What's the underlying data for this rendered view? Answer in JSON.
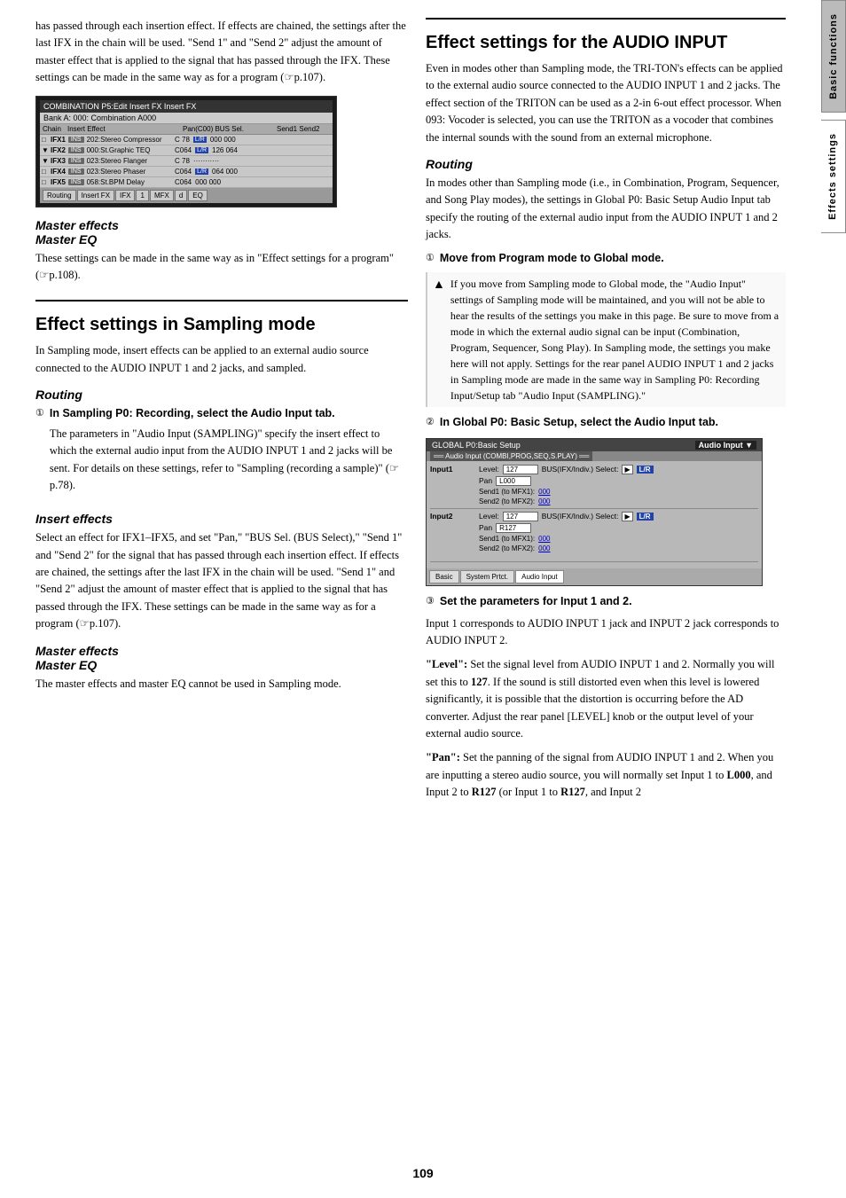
{
  "page": {
    "number": "109",
    "side_tabs": [
      {
        "label": "Basic functions",
        "active": false
      },
      {
        "label": "Effects settings",
        "active": true
      }
    ]
  },
  "left_col": {
    "intro_text": "has passed through each insertion effect. If effects are chained, the settings after the last IFX in the chain will be used. \"Send 1\" and \"Send 2\" adjust the amount of master effect that is applied to the signal that has passed through the IFX. These settings can be made in the same way as for a program (☞p.107).",
    "screenshot": {
      "title": "COMBINATION P5:Edit  Insert FX   Insert FX",
      "row_label": "Bank A: 000: Combination A000",
      "col_headers": [
        "Chain",
        "Insert Effect",
        "Pan(C00) BUS Sel.",
        "Send1 Send2"
      ],
      "rows": [
        {
          "name": "IFX1",
          "effect": "202:Stereo Compressor",
          "flag": "INS",
          "has_lr": true,
          "pan": "C 78",
          "vals": "000 000"
        },
        {
          "name": "IFX2",
          "effect": "000:St.Graphic TEQ",
          "flag": "INS",
          "has_lr": true,
          "pan": "C064",
          "vals": "126 064"
        },
        {
          "name": "IFX3",
          "effect": "023:Stereo Flanger",
          "flag": "INS",
          "has_lr": false,
          "pan": "C 78",
          "vals": ""
        },
        {
          "name": "IFX4",
          "effect": "023:Stereo Phaser",
          "flag": "INS",
          "has_lr": true,
          "pan": "C064",
          "vals": "064 000"
        },
        {
          "name": "IFX5",
          "effect": "058:St.BPM Delay",
          "flag": "INS",
          "has_lr": false,
          "pan": "C064",
          "vals": "000 000"
        }
      ],
      "footer_tabs": [
        "Routing",
        "Insert FX",
        "IFX",
        "MFX",
        "d",
        "EQ"
      ]
    },
    "master_effects_title": "Master effects",
    "master_eq_title": "Master EQ",
    "master_text": "These settings can be made in the same way as in \"Effect settings for a program\" (☞p.108).",
    "sampling_section_title": "Effect settings in Sampling mode",
    "sampling_intro": "In Sampling mode, insert effects can be applied to an external audio source connected to the AUDIO INPUT 1 and 2 jacks, and sampled.",
    "routing_title": "Routing",
    "routing_step1_bold": "In Sampling P0: Recording, select the Audio Input tab.",
    "routing_step1_text": "The parameters in \"Audio Input (SAMPLING)\" specify the insert effect to which the external audio input from the AUDIO INPUT 1 and 2 jacks will be sent. For details on these settings, refer to \"Sampling (recording a sample)\" (☞p.78).",
    "insert_effects_title": "Insert effects",
    "insert_effects_text": "Select an effect for IFX1–IFX5, and set \"Pan,\" \"BUS Sel. (BUS Select),\" \"Send 1\" and \"Send 2\" for the signal that has passed through each insertion effect. If effects are chained, the settings after the last IFX in the chain will be used. \"Send 1\" and \"Send 2\" adjust the amount of master effect that is applied to the signal that has passed through the IFX. These settings can be made in the same way as for a program (☞p.107).",
    "master_effects2_title": "Master effects",
    "master_eq2_title": "Master EQ",
    "master_eq2_text": "The master effects and master EQ cannot be used in Sampling mode."
  },
  "right_col": {
    "audio_input_title": "Effect settings for the AUDIO INPUT",
    "audio_input_intro": "Even in modes other than Sampling mode, the TRI-TON's effects can be applied to the external audio source connected to the AUDIO INPUT 1 and 2 jacks. The effect section of the TRITON can be used as a 2-in 6-out effect processor. When 093: Vocoder is selected, you can use the TRITON as a vocoder that combines the internal sounds with the sound from an external microphone.",
    "routing_title": "Routing",
    "routing_intro": "In modes other than Sampling mode (i.e., in Combination, Program, Sequencer, and Song Play modes), the settings in Global P0: Basic Setup Audio Input tab specify the routing of the external audio input from the AUDIO INPUT 1 and 2 jacks.",
    "step1_circle": "①",
    "step1_bold": "Move from Program mode to Global mode.",
    "note_icon": "⚠",
    "note_text": "If you move from Sampling mode to Global mode, the \"Audio Input\" settings of Sampling mode will be maintained, and you will not be able to hear the results of the settings you make in this page. Be sure to move from a mode in which the external audio signal can be input (Combination, Program, Sequencer, Song Play). In Sampling mode, the settings you make here will not apply. Settings for the rear panel AUDIO INPUT 1 and 2 jacks in Sampling mode are made in the same way in Sampling P0: Recording Input/Setup tab \"Audio Input (SAMPLING).\"",
    "step2_circle": "②",
    "step2_bold": "In Global P0: Basic Setup, select the Audio Input tab.",
    "global_screenshot": {
      "title": "GLOBAL P0:Basic Setup",
      "tab_label": "Audio Input",
      "section_label": "Audio Input (COMBI,PROG,SEQ,S.PLAY)",
      "input1_label": "Input1",
      "input1_level_label": "Level:",
      "input1_level_val": "127",
      "input1_bus": "BUS(IFX/Indiv.) Select:",
      "input1_bus_val": "L/R",
      "input1_pan_label": "Pan",
      "input1_pan_val": "L000",
      "input1_send1": "Send1 (to MFX1): 000",
      "input1_send2": "Send2 (to MFX2): 000",
      "input2_label": "Input2",
      "input2_level_label": "Level:",
      "input2_level_val": "127",
      "input2_bus": "BUS(IFX/Indiv.) Select:",
      "input2_bus_val": "L/R",
      "input2_pan_label": "Pan",
      "input2_pan_val": "R127",
      "input2_send1": "Send1 (to MFX1): 000",
      "input2_send2": "Send2 (to MFX2): 000",
      "footer_tabs": [
        "Basic",
        "System Prtct.",
        "Audio Input"
      ]
    },
    "step3_circle": "③",
    "step3_bold": "Set the parameters for Input 1 and 2.",
    "step3_text1": "Input 1 corresponds to AUDIO INPUT 1 jack and INPUT 2 jack corresponds to AUDIO INPUT 2.",
    "level_bold": "\"Level\":",
    "level_text": " Set the signal level from AUDIO INPUT 1 and 2. Normally you will set this to ",
    "level_val": "127",
    "level_text2": ". If the sound is still distorted even when this level is lowered significantly, it is possible that the distortion is occurring before the AD converter. Adjust the rear panel [LEVEL] knob or the output level of your external audio source.",
    "pan_bold": "\"Pan\":",
    "pan_text": " Set the panning of the signal from AUDIO INPUT 1 and 2. When you are inputting a stereo audio source, you will normally set Input 1 to ",
    "pan_val1": "L000",
    "pan_text2": ", and Input 2 to ",
    "pan_val2": "R127",
    "pan_text3": " (or Input 1 to ",
    "pan_val3": "R127",
    "pan_text4": ", and Input 2",
    "detected_text": "corresponds to AUDIO INPUT and INPUT 2 jack corresponds AUDIO INPUT Jack"
  }
}
